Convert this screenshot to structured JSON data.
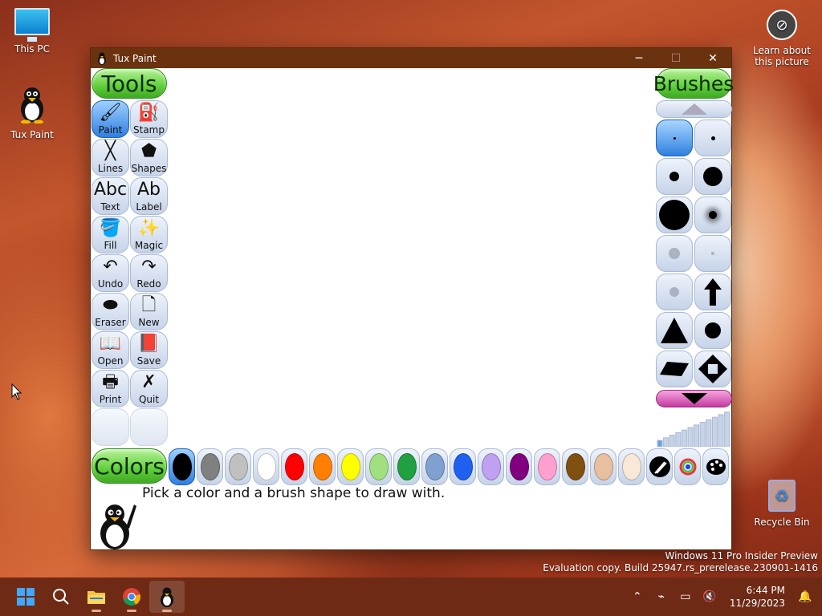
{
  "desktop": {
    "icons": [
      {
        "label": "This PC",
        "icon": "this-pc-icon"
      },
      {
        "label": "Tux Paint",
        "icon": "tux-paint-icon"
      }
    ],
    "learn": {
      "label": "Learn about this picture",
      "icon": "camera-info-icon"
    },
    "recycle": {
      "label": "Recycle Bin",
      "icon": "recycle-bin-icon"
    }
  },
  "window": {
    "title": "Tux Paint",
    "minimize": "─",
    "maximize": "☐",
    "close": "✕"
  },
  "tuxpaint": {
    "tools_label": "Tools",
    "brushes_label": "Brushes",
    "colors_label": "Colors",
    "tools": [
      {
        "label": "Paint",
        "icon": "paint-brush-icon",
        "glyph": "🖌",
        "active": true
      },
      {
        "label": "Stamp",
        "icon": "stamp-icon",
        "glyph": "⛽"
      },
      {
        "label": "Lines",
        "icon": "lines-icon",
        "glyph": "╳"
      },
      {
        "label": "Shapes",
        "icon": "shapes-icon",
        "glyph": "⬟"
      },
      {
        "label": "Text",
        "icon": "text-icon",
        "glyph": "Abc"
      },
      {
        "label": "Label",
        "icon": "label-icon",
        "glyph": "Ab"
      },
      {
        "label": "Fill",
        "icon": "fill-bucket-icon",
        "glyph": "🪣"
      },
      {
        "label": "Magic",
        "icon": "magic-wand-icon",
        "glyph": "✨"
      },
      {
        "label": "Undo",
        "icon": "undo-icon",
        "glyph": "↶"
      },
      {
        "label": "Redo",
        "icon": "redo-icon",
        "glyph": "↷"
      },
      {
        "label": "Eraser",
        "icon": "eraser-icon",
        "glyph": "⬬"
      },
      {
        "label": "New",
        "icon": "new-page-icon",
        "glyph": "🗋"
      },
      {
        "label": "Open",
        "icon": "open-book-icon",
        "glyph": "📖"
      },
      {
        "label": "Save",
        "icon": "save-book-icon",
        "glyph": "📕"
      },
      {
        "label": "Print",
        "icon": "printer-icon",
        "glyph": "🖶"
      },
      {
        "label": "Quit",
        "icon": "quit-icon",
        "glyph": "✗"
      }
    ],
    "colors": [
      "#000000",
      "#808080",
      "#c0c0c0",
      "#ffffff",
      "#ff0000",
      "#ff8000",
      "#ffff00",
      "#a0e080",
      "#20a040",
      "#80a0d0",
      "#2060f0",
      "#c0a0f0",
      "#800080",
      "#ffa0d0",
      "#805010",
      "#e8c0a0",
      "#f8e8d8"
    ],
    "color_tools": [
      {
        "icon": "color-picker-icon"
      },
      {
        "icon": "color-wheel-icon"
      },
      {
        "icon": "palette-icon"
      }
    ],
    "message": "Pick a color and a brush shape to draw with."
  },
  "system": {
    "watermark_line1": "Windows 11 Pro Insider Preview",
    "watermark_line2": "Evaluation copy. Build 25947.rs_prerelease.230901-1416",
    "time": "6:44 PM",
    "date": "11/29/2023"
  },
  "taskbar": {
    "apps": [
      {
        "icon": "start-icon"
      },
      {
        "icon": "search-icon"
      },
      {
        "icon": "file-explorer-icon"
      },
      {
        "icon": "chrome-icon"
      },
      {
        "icon": "tux-paint-taskbar-icon",
        "active": true
      }
    ]
  }
}
